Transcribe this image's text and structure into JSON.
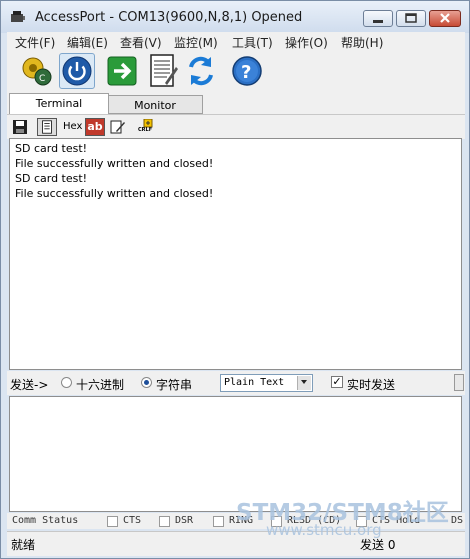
{
  "window": {
    "title": "AccessPort - COM13(9600,N,8,1) Opened"
  },
  "menu": [
    "文件(F)",
    "编辑(E)",
    "查看(V)",
    "监控(M)",
    "工具(T)",
    "操作(O)",
    "帮助(H)"
  ],
  "toolbar_icons": [
    "config-icon",
    "power-icon",
    "arrow-right-icon",
    "notepad-icon",
    "refresh-icon",
    "help-icon"
  ],
  "tabs": {
    "terminal": "Terminal",
    "monitor": "Monitor"
  },
  "subtoolbar": {
    "hex_label": "Hex",
    "ab_label": "ab",
    "crlf_label": "CRLF"
  },
  "terminal_lines": [
    "SD card test!",
    "File successfully written and closed!",
    "SD card test!",
    "File successfully written and closed!"
  ],
  "send": {
    "label": "发送->",
    "hex_option": "十六进制",
    "string_option": "字符串",
    "selected_option": "string",
    "format_value": "Plain Text",
    "realtime_label": "实时发送",
    "realtime_checked": true
  },
  "status": {
    "comm_status": "Comm Status",
    "cts": "CTS",
    "dsr": "DSR",
    "ring": "RING",
    "rlsd": "RLSD (CD)",
    "cts_hold": "CTS Hold",
    "ds": "DS"
  },
  "bottom": {
    "ready": "就绪",
    "sent": "发送 0"
  },
  "watermark": {
    "line1": "STM32/STM8社区",
    "line2": "www.stmcu.org"
  },
  "colors": {
    "title_gradient_top": "#e9f0f9",
    "close_button": "#c74b35",
    "radio_dot": "#1e4f9a"
  }
}
